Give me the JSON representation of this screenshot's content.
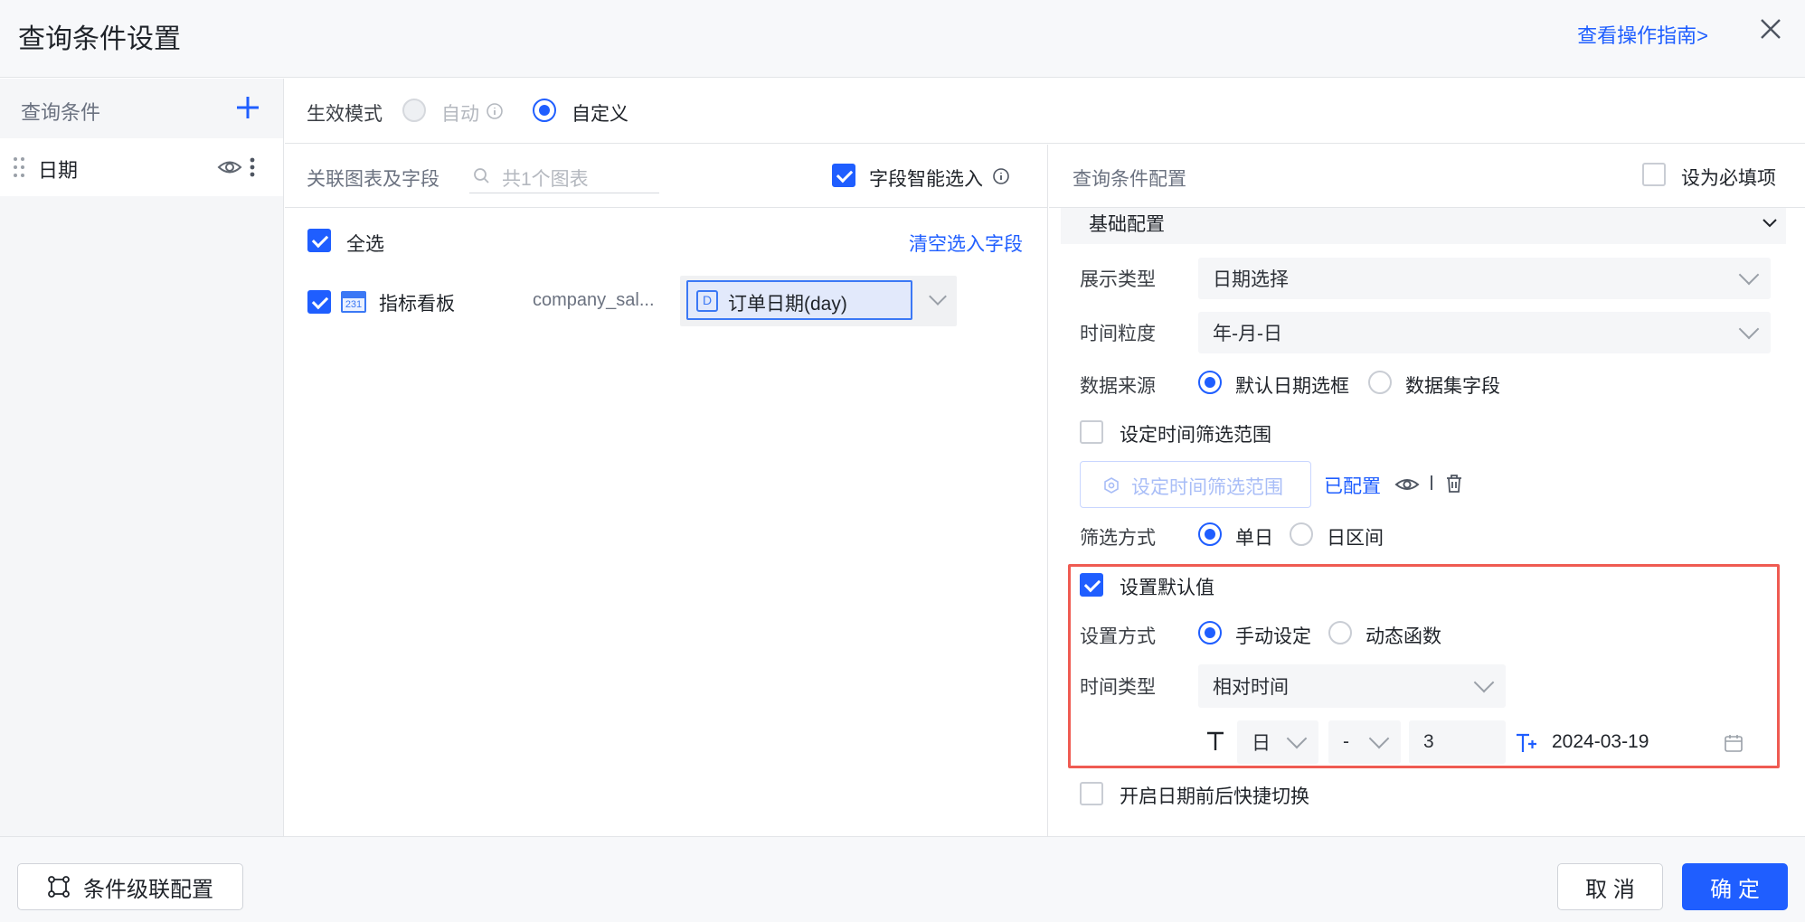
{
  "header": {
    "title": "查询条件设置",
    "guide_link": "查看操作指南>"
  },
  "sidebar": {
    "heading": "查询条件",
    "items": [
      {
        "label": "日期"
      }
    ]
  },
  "mode": {
    "label": "生效模式",
    "options": [
      "自动",
      "自定义"
    ],
    "selected": "自定义"
  },
  "middle": {
    "heading": "关联图表及字段",
    "search_placeholder": "共1个图表",
    "smart_select_label": "字段智能选入",
    "select_all_label": "全选",
    "clear_link": "清空选入字段",
    "rows": [
      {
        "chart_icon_text": "231",
        "chart_name": "指标看板",
        "dataset": "company_sal...",
        "field_badge": "D",
        "field": "订单日期(day)"
      }
    ]
  },
  "right": {
    "heading": "查询条件配置",
    "required_label": "设为必填项",
    "section_title": "基础配置",
    "display_type_label": "展示类型",
    "display_type_value": "日期选择",
    "granularity_label": "时间粒度",
    "granularity_value": "年-月-日",
    "source_label": "数据来源",
    "source_options": [
      "默认日期选框",
      "数据集字段"
    ],
    "range_check_label": "设定时间筛选范围",
    "range_button": "设定时间筛选范围",
    "configured_link": "已配置",
    "filter_label": "筛选方式",
    "filter_options": [
      "单日",
      "日区间"
    ],
    "default_check_label": "设置默认值",
    "set_mode_label": "设置方式",
    "set_mode_options": [
      "手动设定",
      "动态函数"
    ],
    "time_type_label": "时间类型",
    "time_type_value": "相对时间",
    "unit_value": "日",
    "op_value": "-",
    "offset_value": "3",
    "date_value": "2024-03-19",
    "quick_switch_label": "开启日期前后快捷切换"
  },
  "footer": {
    "cascade_button": "条件级联配置",
    "cancel_button": "取 消",
    "ok_button": "确 定"
  },
  "colors": {
    "accent": "#1f5eff",
    "highlight_border": "#ef5b52"
  }
}
